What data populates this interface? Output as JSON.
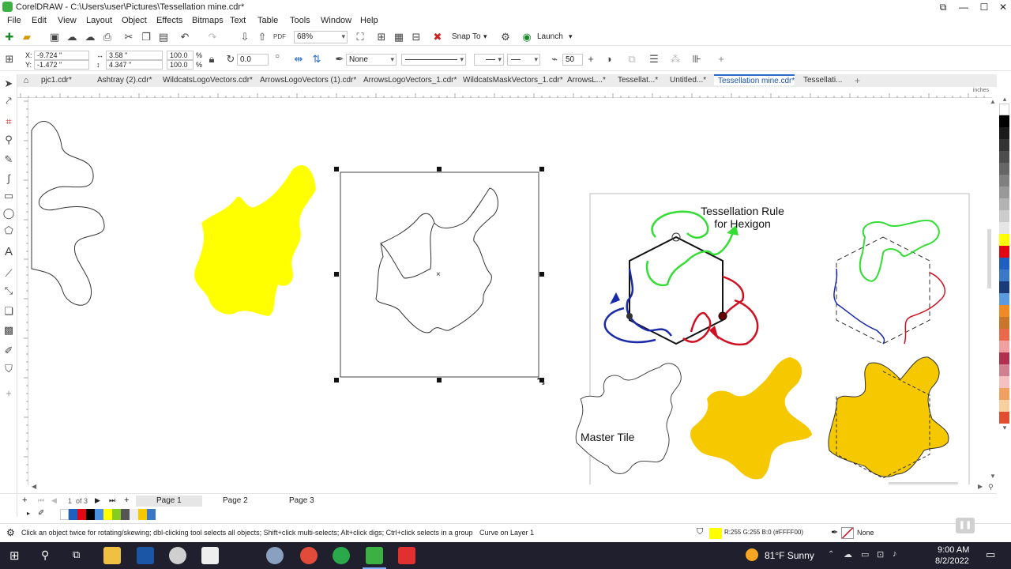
{
  "window": {
    "title": "CorelDRAW - C:\\Users\\user\\Pictures\\Tessellation mine.cdr*",
    "controls": [
      "minimize",
      "maximize",
      "close"
    ]
  },
  "menu": [
    "File",
    "Edit",
    "View",
    "Layout",
    "Object",
    "Effects",
    "Bitmaps",
    "Text",
    "Table",
    "Tools",
    "Window",
    "Help"
  ],
  "toolbar": {
    "zoom": "68%",
    "snap_to": "Snap To",
    "launch": "Launch"
  },
  "property_bar": {
    "x": "-9.724 \"",
    "y": "-1.472 \"",
    "width": "3.58 \"",
    "height": "4.347 \"",
    "scale_w": "100.0",
    "scale_h": "100.0",
    "percent": "%",
    "rotation": "0.0",
    "outline_fill": "None",
    "smoothing": "50"
  },
  "doc_tabs": [
    "pjc1.cdr*",
    "Ashtray (2).cdr*",
    "WildcatsLogoVectors.cdr*",
    "ArrowsLogoVectors (1).cdr*",
    "ArrowsLogoVectors_1.cdr*",
    "WildcatsMaskVectors_1.cdr*",
    "ArrowsL...*",
    "Tessellat...*",
    "Untitled...*",
    "Tessellation mine.cdr*",
    "Tessellati..."
  ],
  "active_tab": "Tessellation mine.cdr*",
  "ruler_unit": "inches",
  "canvas_text": {
    "rule_title_1": "Tessellation Rule",
    "rule_title_2": "for Hexigon",
    "master_tile": "Master Tile"
  },
  "pages": {
    "counter": "1",
    "of": "of 3",
    "tabs": [
      "Page 1",
      "Page 2",
      "Page 3"
    ],
    "active": "Page 1"
  },
  "status": {
    "hint": "Click an object twice for rotating/skewing; dbl-clicking tool selects all objects; Shift+click multi-selects; Alt+click digs; Ctrl+click selects in a group",
    "object_info": "Curve on Layer 1",
    "fill_info": "R:255 G:255 B:0 (#FFFF00)",
    "outline_info": "None"
  },
  "taskbar": {
    "weather": "81°F  Sunny",
    "time": "9:00 AM",
    "date": "8/2/2022"
  },
  "colors": {
    "accent": "#2a6bc7",
    "fill_yellow": "#FFFF00",
    "tile_gold": "#f5c800",
    "green": "#33dd33",
    "red": "#d01020",
    "blue": "#1a2aa8"
  }
}
